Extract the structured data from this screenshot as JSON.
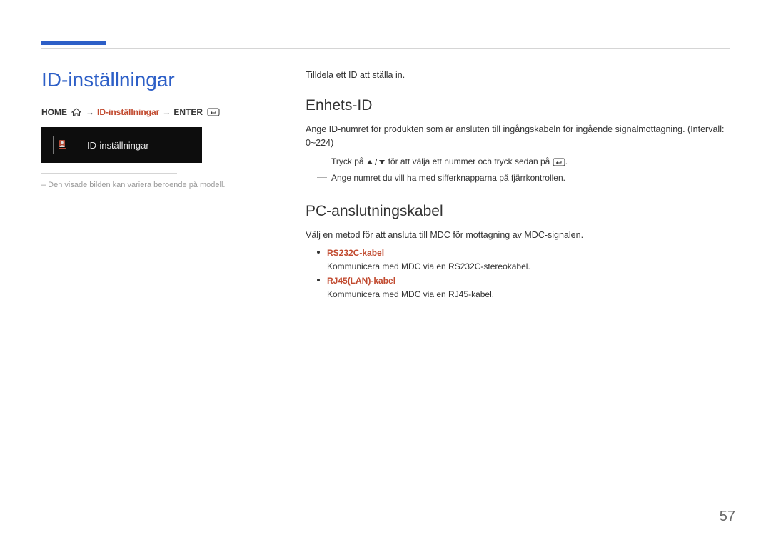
{
  "pageNumber": "57",
  "left": {
    "title": "ID-inställningar",
    "breadcrumb": {
      "home": "HOME",
      "current": "ID-inställningar",
      "enter": "ENTER"
    },
    "osdLabel": "ID-inställningar",
    "caption": "– Den visade bilden kan variera beroende på modell."
  },
  "right": {
    "intro": "Tilldela ett ID att ställa in.",
    "section1": {
      "heading": "Enhets-ID",
      "body": "Ange ID-numret för produkten som är ansluten till ingångskabeln för ingående signalmottagning. (Intervall: 0~224)",
      "note1a": "Tryck på ",
      "note1b": " för att välja ett nummer och tryck sedan på ",
      "note1c": ".",
      "note2": "Ange numret du vill ha med sifferknapparna på fjärrkontrollen."
    },
    "section2": {
      "heading": "PC-anslutningskabel",
      "body": "Välj en metod för att ansluta till MDC för mottagning av MDC-signalen.",
      "bullets": [
        {
          "title": "RS232C-kabel",
          "desc": "Kommunicera med MDC via en RS232C-stereokabel."
        },
        {
          "title": "RJ45(LAN)-kabel",
          "desc": "Kommunicera med MDC via en RJ45-kabel."
        }
      ]
    }
  }
}
